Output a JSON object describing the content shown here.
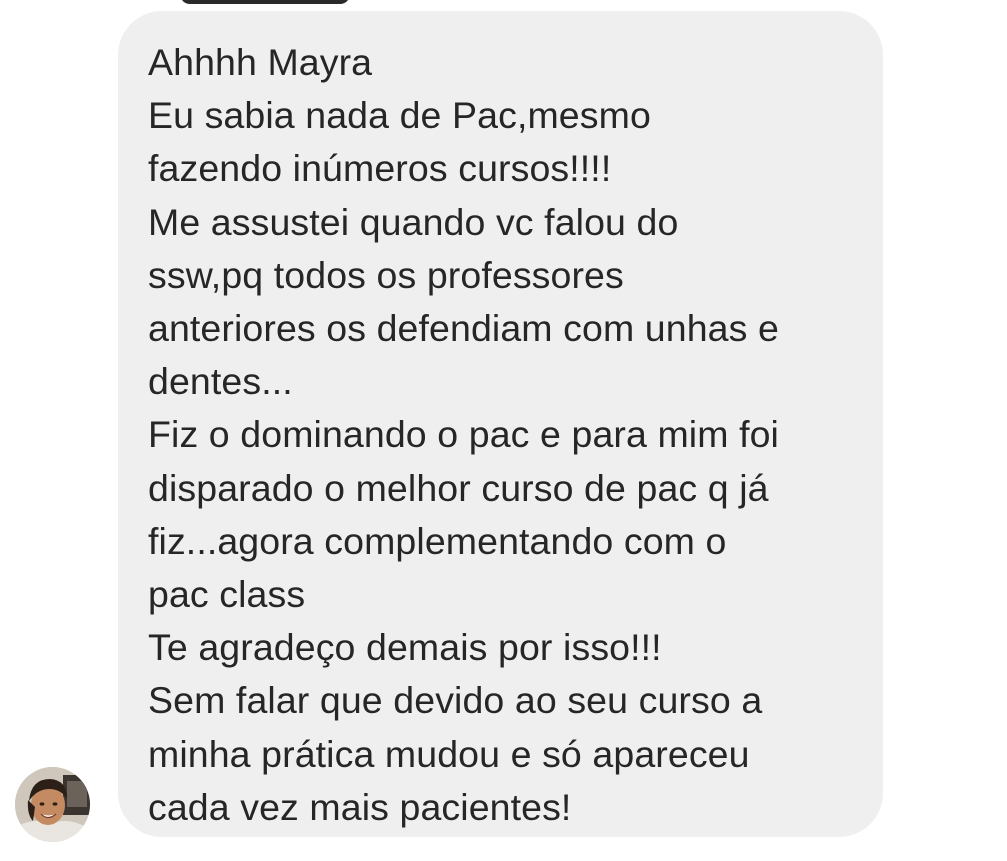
{
  "conversation": {
    "message": {
      "lines": [
        "Ahhhh Mayra",
        "Eu sabia nada de Pac,mesmo",
        "fazendo inúmeros cursos!!!!",
        "Me assustei quando vc falou do",
        "ssw,pq todos os professores",
        "anteriores os defendiam com unhas e",
        "dentes...",
        "Fiz o dominando o pac e para mim foi",
        "disparado o melhor curso de pac q já",
        "fiz...agora complementando com o",
        "pac class",
        "Te agradeço demais por isso!!!",
        "Sem falar que devido ao seu curso a",
        "minha prática mudou e só apareceu",
        "cada vez mais pacientes!"
      ]
    },
    "sender": {
      "avatar_icon": "user-avatar-photo"
    },
    "colors": {
      "bubble_background": "#efefef",
      "text": "#262626",
      "page_background": "#ffffff"
    }
  }
}
